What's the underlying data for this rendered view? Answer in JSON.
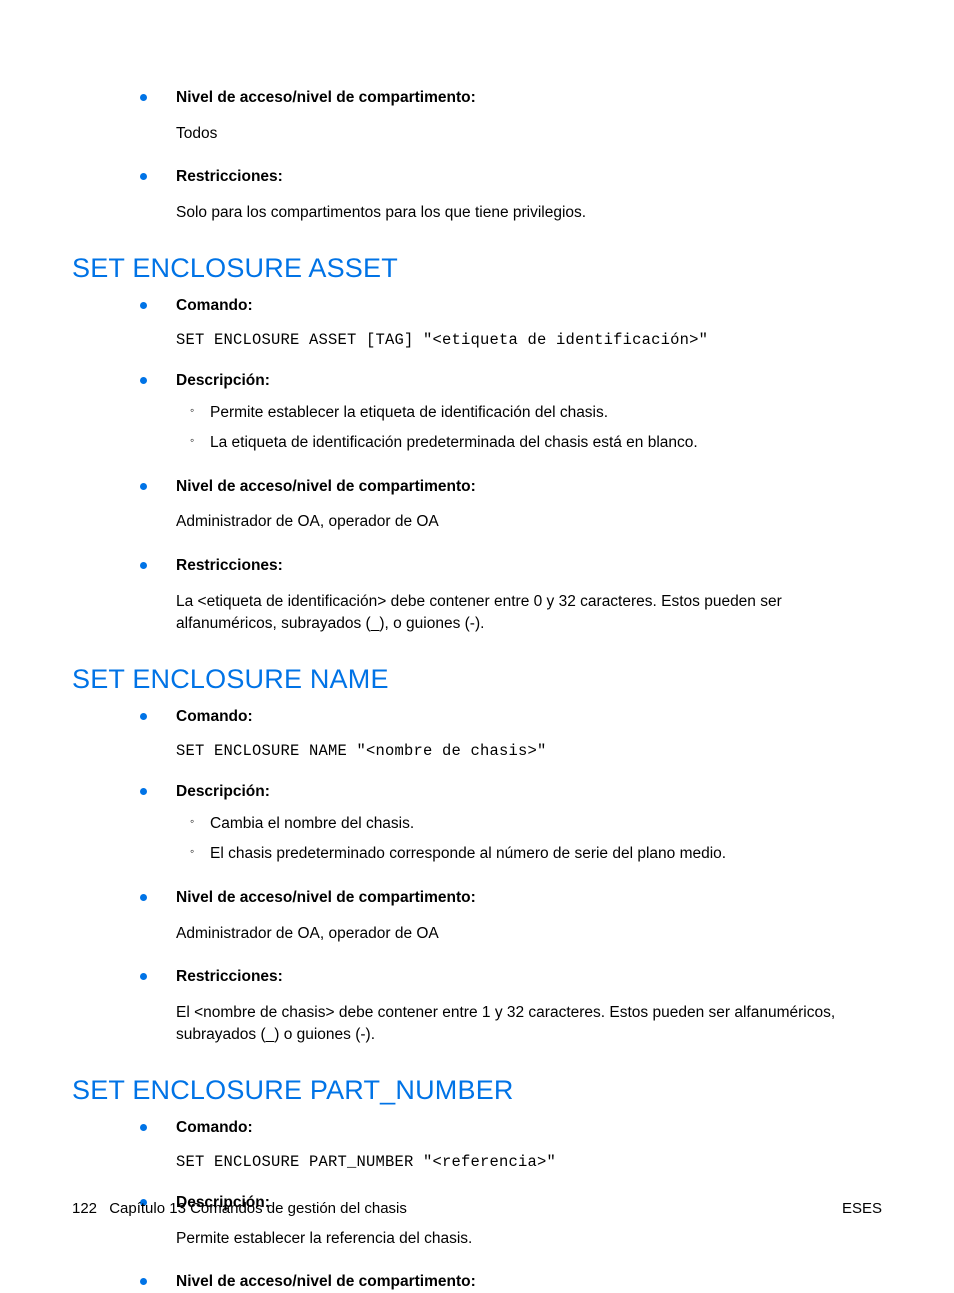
{
  "intro": {
    "items": [
      {
        "label": "Nivel de acceso/nivel de compartimento:",
        "body": "Todos"
      },
      {
        "label": "Restricciones:",
        "body": "Solo para los compartimentos para los que tiene privilegios."
      }
    ]
  },
  "sections": [
    {
      "heading": "SET ENCLOSURE ASSET",
      "items": [
        {
          "label": "Comando:",
          "code": "SET ENCLOSURE ASSET [TAG] \"<etiqueta de identificación>\""
        },
        {
          "label": "Descripción:",
          "sub": [
            "Permite establecer la etiqueta de identificación del chasis.",
            "La etiqueta de identificación predeterminada del chasis está en blanco."
          ]
        },
        {
          "label": "Nivel de acceso/nivel de compartimento:",
          "body": "Administrador de OA, operador de OA"
        },
        {
          "label": "Restricciones:",
          "body": "La <etiqueta de identificación> debe contener entre 0 y 32 caracteres. Estos pueden ser alfanuméricos, subrayados (_), o guiones (-)."
        }
      ]
    },
    {
      "heading": "SET ENCLOSURE NAME",
      "items": [
        {
          "label": "Comando:",
          "code": "SET ENCLOSURE NAME \"<nombre de chasis>\""
        },
        {
          "label": "Descripción:",
          "sub": [
            "Cambia el nombre del chasis.",
            "El chasis predeterminado corresponde al número de serie del plano medio."
          ]
        },
        {
          "label": "Nivel de acceso/nivel de compartimento:",
          "body": "Administrador de OA, operador de OA"
        },
        {
          "label": "Restricciones:",
          "body": "El <nombre de chasis> debe contener entre 1 y 32 caracteres. Estos pueden ser alfanuméricos, subrayados (_) o guiones (-)."
        }
      ]
    },
    {
      "heading": "SET ENCLOSURE PART_NUMBER",
      "items": [
        {
          "label": "Comando:",
          "code": "SET ENCLOSURE PART_NUMBER \"<referencia>\""
        },
        {
          "label": "Descripción:",
          "body": "Permite establecer la referencia del chasis."
        },
        {
          "label": "Nivel de acceso/nivel de compartimento:"
        }
      ]
    }
  ],
  "footer": {
    "page_number": "122",
    "chapter": "Capítulo 13   Comandos de gestión del chasis",
    "lang": "ESES"
  }
}
